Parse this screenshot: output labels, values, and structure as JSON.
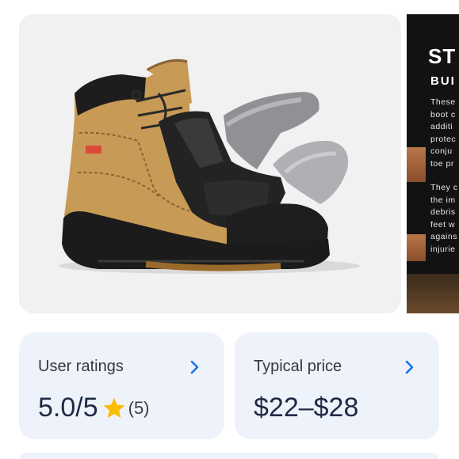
{
  "gallery": {
    "next_image": {
      "title": "ST",
      "subtitle": "BUI",
      "para1": [
        "These",
        "boot c",
        "additi",
        "protec",
        "conju",
        "toe pr"
      ],
      "para2": [
        "They c",
        "the im",
        "debris",
        "feet w",
        "agains",
        "injurie"
      ]
    }
  },
  "ratings": {
    "label": "User ratings",
    "value": "5.0/5",
    "count": "(5)",
    "star_color": "#fbbc04",
    "icon": "chevron-right-icon"
  },
  "price": {
    "label": "Typical price",
    "value": "$22–$28",
    "icon": "chevron-right-icon"
  },
  "colors": {
    "accent": "#1a73e8",
    "card_bg": "#eef3fb"
  }
}
